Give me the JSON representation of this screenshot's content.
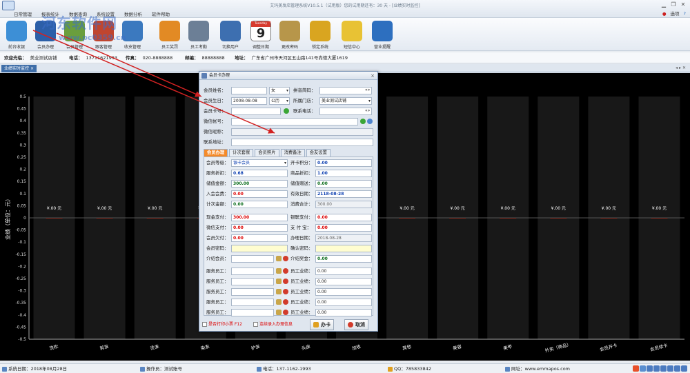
{
  "app": {
    "title": "艾玛美发店管理系统V10.5.1（试用版）您的试用期还有：30 天 - [业绩实时监控]",
    "menu": [
      "日常管理",
      "报表统计",
      "数据查询",
      "系统设置",
      "数据分析",
      "软件帮助"
    ],
    "options_label": "选项"
  },
  "watermark": {
    "text": "河东软件网",
    "url": "www.pc0359.cn"
  },
  "toolbar": {
    "items": [
      {
        "label": "前台收银",
        "icon": "cashier-icon",
        "color": "#3d8fd6"
      },
      {
        "label": "会员办理",
        "icon": "member-card-icon",
        "color": "#2c5fa8"
      },
      {
        "label": "会员管理",
        "icon": "members-icon",
        "color": "#6a9e3d"
      },
      {
        "label": "跟客管理",
        "icon": "customer-icon",
        "color": "#c0452f"
      },
      {
        "label": "收支管理",
        "icon": "ledger-icon",
        "color": "#3b79bf"
      },
      {
        "label": "员工奖罚",
        "icon": "reward-icon",
        "color": "#e28a24"
      },
      {
        "label": "员工考勤",
        "icon": "clock-icon",
        "color": "#6c7f96"
      },
      {
        "label": "切换用户",
        "icon": "switch-user-icon",
        "color": "#3d6fb0"
      },
      {
        "label": "调整日期",
        "icon": "calendar-icon",
        "color": "#d73a2e"
      },
      {
        "label": "更改密码",
        "icon": "key-icon",
        "color": "#b7964a"
      },
      {
        "label": "锁定系统",
        "icon": "lock-icon",
        "color": "#d9a520"
      },
      {
        "label": "短信中心",
        "icon": "sms-icon",
        "color": "#e8c234"
      },
      {
        "label": "营业提醒",
        "icon": "reminder-icon",
        "color": "#2d6fbf"
      }
    ],
    "calendar": {
      "head": "Tuesday",
      "day": "9"
    }
  },
  "infobar": {
    "welcome_label": "欢迎光临：",
    "welcome": "美业测试店铺",
    "phone_label": "电话：",
    "phone": "13711621993",
    "fax_label": "传真：",
    "fax": "020-8888888",
    "postcode_label": "邮编：",
    "postcode": "88888888",
    "address_label": "地址：",
    "address": "广东省广州市天河区五山路141号尚德大厦1619"
  },
  "tab": {
    "label": "业绩实时监控",
    "close": "×",
    "nav": "◂ ▸ ✕"
  },
  "chart_data": {
    "type": "bar",
    "title": "业绩实时监控",
    "ylabel": "业绩（单位：元）",
    "ylim": [
      -0.5,
      0.5
    ],
    "yticks": [
      0.5,
      0.45,
      0.4,
      0.35,
      0.3,
      0.25,
      0.2,
      0.15,
      0.1,
      0.05,
      0,
      -0.05,
      -0.1,
      -0.15,
      -0.2,
      -0.25,
      -0.3,
      -0.35,
      -0.4,
      -0.45,
      -0.5
    ],
    "categories": [
      "洗吹",
      "剪发",
      "烫发",
      "染发",
      "护发",
      "头皮",
      "加收",
      "其他",
      "美容",
      "美甲",
      "外卖（商品）",
      "会员开卡",
      "会员续卡"
    ],
    "values": [
      0,
      0,
      0,
      0,
      0,
      0,
      0,
      0,
      0,
      0,
      0,
      0,
      0
    ],
    "data_labels": [
      "¥.00 元",
      "¥.00 元",
      "¥.00 元",
      "¥.00 元",
      "¥.00 元",
      "¥.00 元",
      "¥.00 元",
      "¥.00 元",
      "¥.00 元",
      "¥.00 元",
      "¥.00 元",
      "¥.00 元",
      "¥.00 元"
    ],
    "grid": false,
    "background": "#000000"
  },
  "dialog": {
    "title": "会员卡办理",
    "close": "×",
    "name_label": "会员姓名：",
    "name": "",
    "gender": "女",
    "pinyin_label": "拼音简码：",
    "pinyin": "",
    "pinyin_btn": "«»",
    "birthday_label": "会员生日：",
    "birthday": "2008-08-08",
    "calendar_type": "公历",
    "store_label": "所属门店：",
    "store": "美业测试店铺",
    "card_label": "会员卡号：",
    "card": "",
    "tel_label": "联系电话：",
    "tel": "",
    "tel_btn": "«»",
    "wechat_label": "微信帐号：",
    "wechat": "",
    "wechat_nick_label": "微信昵称：",
    "wechat_nick": "",
    "address_label": "联系地址：",
    "address": "",
    "tabs": [
      "会员办理",
      "计次套餐",
      "会员照片",
      "消费备注",
      "会友设置"
    ],
    "grade_label": "会员等级：",
    "grade": "银卡会员",
    "points_label": "开卡积分：",
    "points": "0.00",
    "service_discount_label": "服务折扣：",
    "service_discount": "0.68",
    "goods_discount_label": "商品折扣：",
    "goods_discount": "1.00",
    "stored_label": "储值金额：",
    "stored": "300.00",
    "gift_label": "储值赠送：",
    "gift": "0.00",
    "fee_label": "入会会费：",
    "fee": "0.00",
    "expiry_label": "有效日期：",
    "expiry": "2118-08-28",
    "count_label": "计次金额：",
    "count": "0.00",
    "total_label": "消费合计：",
    "total": "300.00",
    "cash_label": "现金支付：",
    "cash": "300.00",
    "union_label": "银联支付：",
    "union": "0.00",
    "wxpay_label": "微信支付：",
    "wxpay": "0.00",
    "alipay_label": "支 付 宝：",
    "alipay": "0.00",
    "owe_label": "会员欠付：",
    "owe": "0.00",
    "op_date_label": "办理日期：",
    "op_date": "2018-08-28",
    "pwd_label": "会员密码：",
    "pwd": "",
    "pwd2_label": "确认密码：",
    "pwd2": "",
    "referrer_label": "介绍会员：",
    "referrer": "",
    "reward_label": "介绍奖金：",
    "reward": "0.00",
    "staff_label": "服务员工：",
    "perf_label": "员工业绩：",
    "staff": [
      {
        "name": "",
        "perf": "0.00"
      },
      {
        "name": "",
        "perf": "0.00"
      },
      {
        "name": "",
        "perf": "0.00"
      },
      {
        "name": "",
        "perf": "0.00"
      },
      {
        "name": "",
        "perf": "0.00"
      }
    ],
    "print_label": "是否打印小票 F12",
    "continuous_label": "连续录入办理信息",
    "submit_label": "办卡",
    "cancel_label": "取消"
  },
  "status": {
    "date_label": "系统日期：",
    "date": "2018年08月28日",
    "op_label": "操作员：",
    "op": "测试账号",
    "tel_label": "电话：",
    "tel": "137-1162-1993",
    "qq_label": "QQ：",
    "qq": "785833842",
    "web_label": "网址：",
    "web": "www.emmapos.com"
  },
  "colors": {
    "accent": "#3f6ea8",
    "orange_tab": "#f58a28",
    "arrow": "#d22222"
  }
}
